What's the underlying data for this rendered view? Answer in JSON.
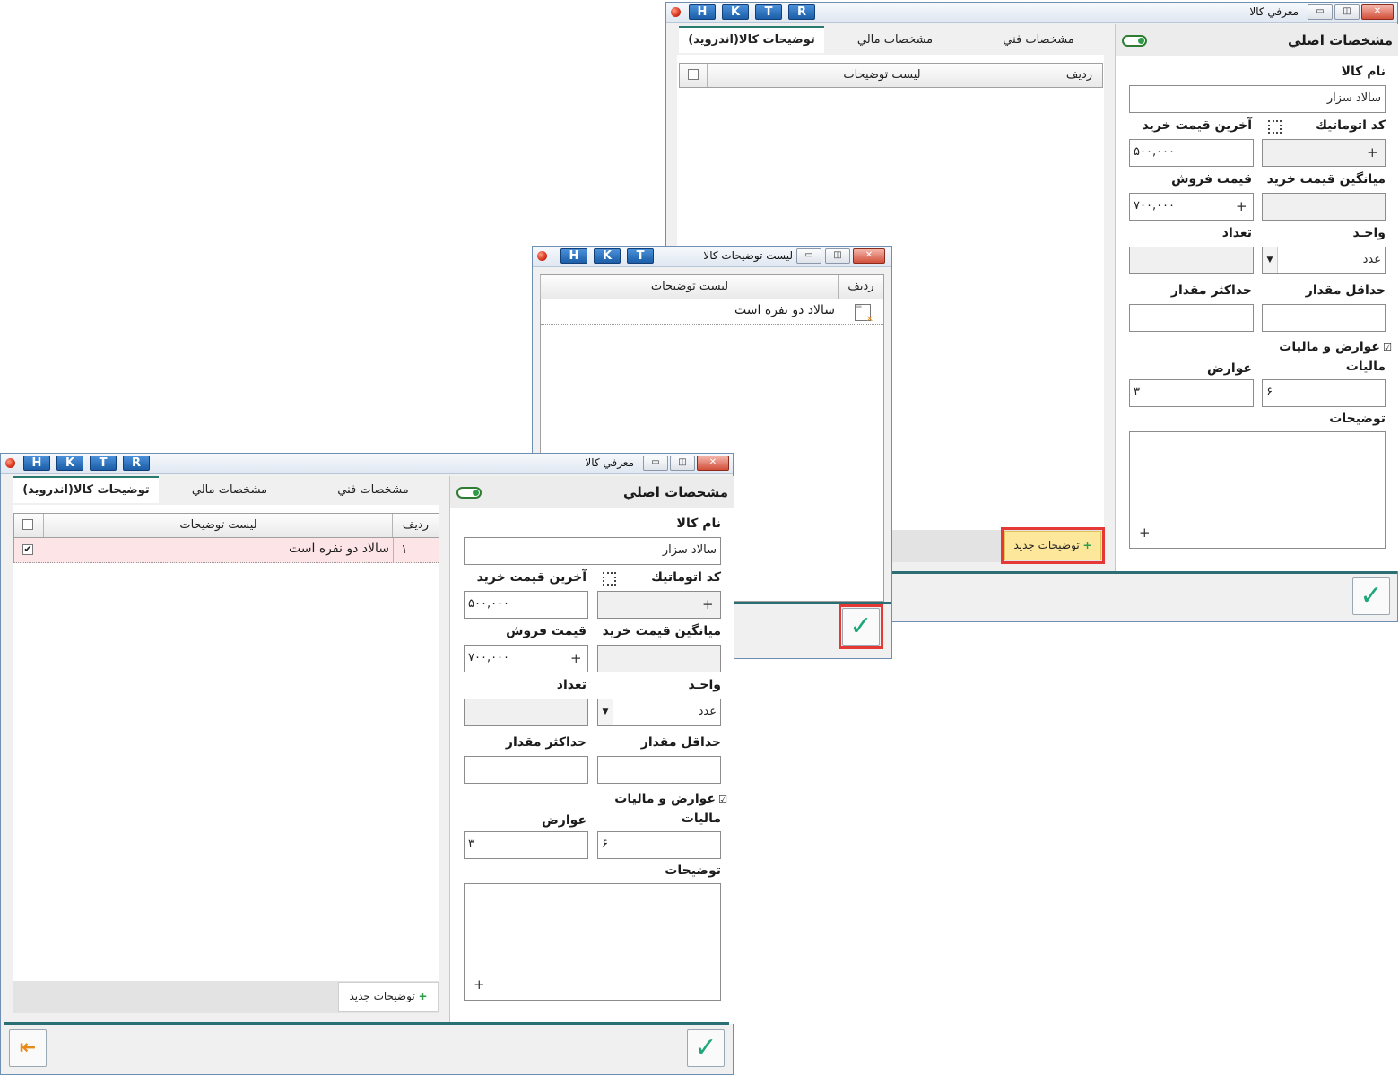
{
  "titlebar": {
    "btn_h": "H",
    "btn_k": "K",
    "btn_t": "T",
    "btn_r": "R",
    "minimize": "▭",
    "restore": "◫",
    "close": "✕"
  },
  "main_window": {
    "title": "معرفي كالا"
  },
  "list_window": {
    "title": "ليست توضيحات كالا",
    "col_row": "رديف",
    "col_desc": "ليست توضيحات",
    "row_text": "سالاد دو نفره است"
  },
  "tabs": {
    "main": "مشخصات اصلي",
    "technical": "مشخصات فني",
    "financial": "مشخصات مالي",
    "android": "توضيحات كالا(اندرويد)"
  },
  "form": {
    "product_name_label": "نام كالا",
    "product_name": "سالاد سزار",
    "auto_code_label": "كد اتوماتيك",
    "last_purchase_label": "آخرين قيمت خريد",
    "last_purchase": "۵۰۰,۰۰۰",
    "avg_purchase_label": "ميانگين قيمت خريد",
    "sale_price_label": "قيمت فروش",
    "sale_price": "۷۰۰,۰۰۰",
    "unit_label": "واحـد",
    "unit": "عدد",
    "count_label": "تعداد",
    "min_qty_label": "حداقل مقدار",
    "max_qty_label": "حداكثر مقدار",
    "tax_checkbox_label": "عوارض و ماليات",
    "tax_label": "ماليات",
    "tax": "۶",
    "duty_label": "عوارض",
    "duty": "۳",
    "notes_label": "توضيحات",
    "plus": "+"
  },
  "desc_grid": {
    "col_row": "رديف",
    "col_desc": "ليست توضيحات",
    "rows": [
      {
        "index": "۱",
        "text": "سالاد دو نفره است",
        "checked": true
      }
    ]
  },
  "buttons": {
    "new_desc": "توضيحات جديد",
    "ok": "✓",
    "exit": "⇤"
  },
  "colors": {
    "accent": "#2b6e73",
    "highlight_row": "#fde4e6",
    "new_button_highlight": "#fde79a",
    "callout": "#e53935",
    "ok": "#1fa67a"
  }
}
